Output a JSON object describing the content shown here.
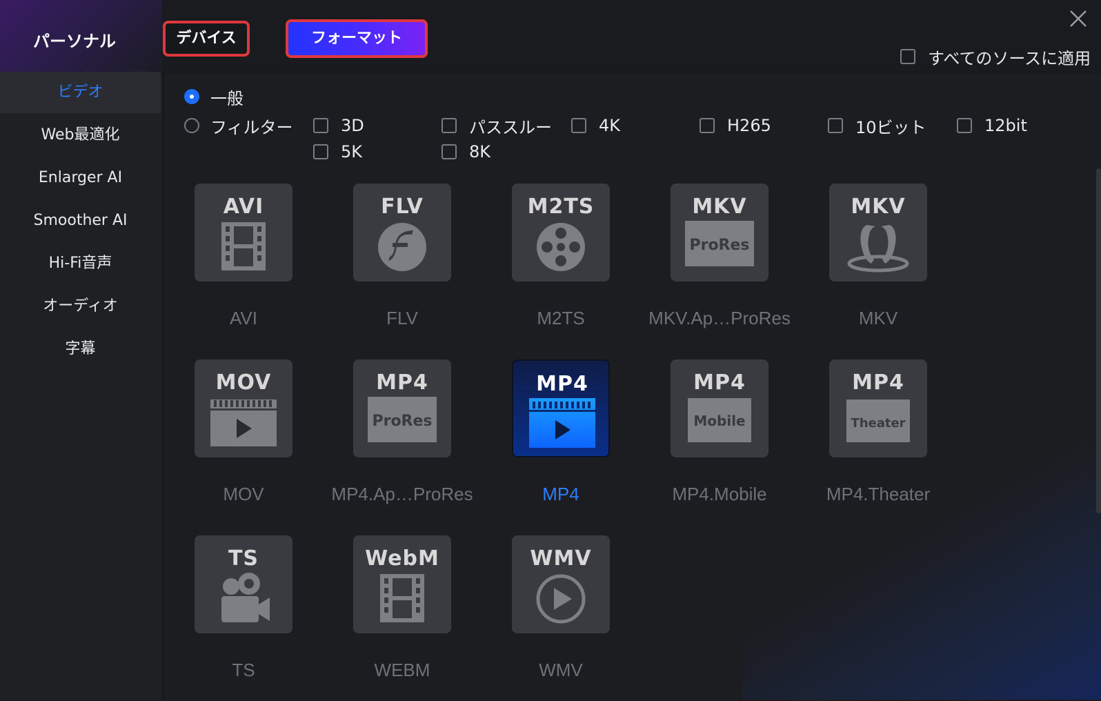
{
  "header": {
    "personal_label": "パーソナル",
    "tab_device": "デバイス",
    "tab_format": "フォーマット",
    "apply_all_label": "すべてのソースに適用"
  },
  "sidebar": {
    "items": [
      {
        "label": "ビデオ",
        "active": true
      },
      {
        "label": "Web最適化",
        "active": false
      },
      {
        "label": "Enlarger AI",
        "active": false
      },
      {
        "label": "Smoother AI",
        "active": false
      },
      {
        "label": "Hi-Fi音声",
        "active": false
      },
      {
        "label": "オーディオ",
        "active": false
      },
      {
        "label": "字幕",
        "active": false
      }
    ]
  },
  "filters": {
    "general_label": "一般",
    "filter_label": "フィルター",
    "options": [
      "3D",
      "パススルー",
      "4K",
      "H265",
      "10ビット",
      "12bit",
      "5K",
      "8K"
    ]
  },
  "formats": [
    {
      "badge": "AVI",
      "sublabel": "",
      "name": "AVI",
      "icon": "film-strip-icon",
      "selected": false
    },
    {
      "badge": "FLV",
      "sublabel": "",
      "name": "FLV",
      "icon": "flash-icon",
      "selected": false
    },
    {
      "badge": "M2TS",
      "sublabel": "",
      "name": "M2TS",
      "icon": "film-reel-icon",
      "selected": false
    },
    {
      "badge": "MKV",
      "sublabel": "ProRes",
      "name": "MKV.Ap…ProRes",
      "icon": "prores-box-icon",
      "selected": false
    },
    {
      "badge": "MKV",
      "sublabel": "",
      "name": "MKV",
      "icon": "matroska-icon",
      "selected": false
    },
    {
      "badge": "MOV",
      "sublabel": "",
      "name": "MOV",
      "icon": "video-player-icon",
      "selected": false
    },
    {
      "badge": "MP4",
      "sublabel": "ProRes",
      "name": "MP4.Ap…ProRes",
      "icon": "prores-box-icon",
      "selected": false
    },
    {
      "badge": "MP4",
      "sublabel": "",
      "name": "MP4",
      "icon": "video-player-icon",
      "selected": true
    },
    {
      "badge": "MP4",
      "sublabel": "Mobile",
      "name": "MP4.Mobile",
      "icon": "mobile-box-icon",
      "selected": false
    },
    {
      "badge": "MP4",
      "sublabel": "Theater",
      "name": "MP4.Theater",
      "icon": "theater-box-icon",
      "selected": false
    },
    {
      "badge": "TS",
      "sublabel": "",
      "name": "TS",
      "icon": "video-camera-icon",
      "selected": false
    },
    {
      "badge": "WebM",
      "sublabel": "",
      "name": "WEBM",
      "icon": "film-strip-icon",
      "selected": false
    },
    {
      "badge": "WMV",
      "sublabel": "",
      "name": "WMV",
      "icon": "play-circle-icon",
      "selected": false
    }
  ],
  "colors": {
    "accent": "#2e7dff",
    "highlight_border": "#e0383f",
    "format_tab_gradient_start": "#2433ff",
    "format_tab_gradient_end": "#7b23f5"
  }
}
